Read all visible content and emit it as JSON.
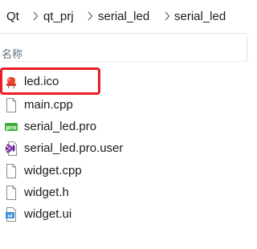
{
  "breadcrumb": {
    "items": [
      "Qt",
      "qt_prj",
      "serial_led",
      "serial_led"
    ]
  },
  "columns": {
    "name_header": "名称"
  },
  "files": [
    {
      "name": "led.ico",
      "icon": "ico-file-icon"
    },
    {
      "name": "main.cpp",
      "icon": "document-icon"
    },
    {
      "name": "serial_led.pro",
      "icon": "qt-pro-file-icon"
    },
    {
      "name": "serial_led.pro.user",
      "icon": "visual-studio-file-icon"
    },
    {
      "name": "widget.cpp",
      "icon": "document-icon"
    },
    {
      "name": "widget.h",
      "icon": "document-icon"
    },
    {
      "name": "widget.ui",
      "icon": "qt-ui-file-icon"
    }
  ],
  "highlight": {
    "target": "led.ico",
    "color": "#ea1d25"
  }
}
